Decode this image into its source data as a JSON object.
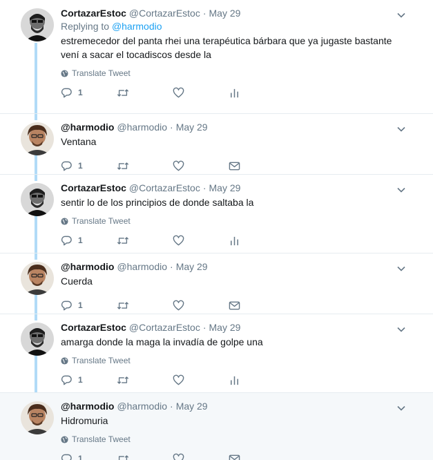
{
  "tweets": [
    {
      "fullname": "CortazarEstoc",
      "username": "@CortazarEstoc",
      "dot": "·",
      "time": "May 29",
      "replying_prefix": "Replying to ",
      "replying_to": "@harmodio",
      "text": "estremecedor del panta rhei una terapéutica bárbara que ya jugaste bastante\nvení a sacar el tocadiscos desde la",
      "translate": "Translate Tweet",
      "reply_count": "1",
      "last_action_icon": "analytics-icon"
    },
    {
      "fullname": "@harmodio",
      "username": "@harmodio",
      "dot": "·",
      "time": "May 29",
      "text": "Ventana",
      "reply_count": "1",
      "last_action_icon": "direct-message-icon"
    },
    {
      "fullname": "CortazarEstoc",
      "username": "@CortazarEstoc",
      "dot": "·",
      "time": "May 29",
      "text": "sentir lo de los principios de donde saltaba la",
      "translate": "Translate Tweet",
      "reply_count": "1",
      "last_action_icon": "analytics-icon"
    },
    {
      "fullname": "@harmodio",
      "username": "@harmodio",
      "dot": "·",
      "time": "May 29",
      "text": "Cuerda",
      "reply_count": "1",
      "last_action_icon": "direct-message-icon"
    },
    {
      "fullname": "CortazarEstoc",
      "username": "@CortazarEstoc",
      "dot": "·",
      "time": "May 29",
      "text": "amarga donde la maga la invadía de golpe una",
      "translate": "Translate Tweet",
      "reply_count": "1",
      "last_action_icon": "analytics-icon"
    },
    {
      "fullname": "@harmodio",
      "username": "@harmodio",
      "dot": "·",
      "time": "May 29",
      "text": "Hidromuria",
      "translate": "Translate Tweet",
      "reply_count": "1",
      "last_action_icon": "direct-message-icon"
    }
  ],
  "colors": {
    "link": "#1da1f2",
    "thread_line": "#b1dbf7",
    "muted": "#657786",
    "highlight_bg": "#f5f8fa"
  }
}
